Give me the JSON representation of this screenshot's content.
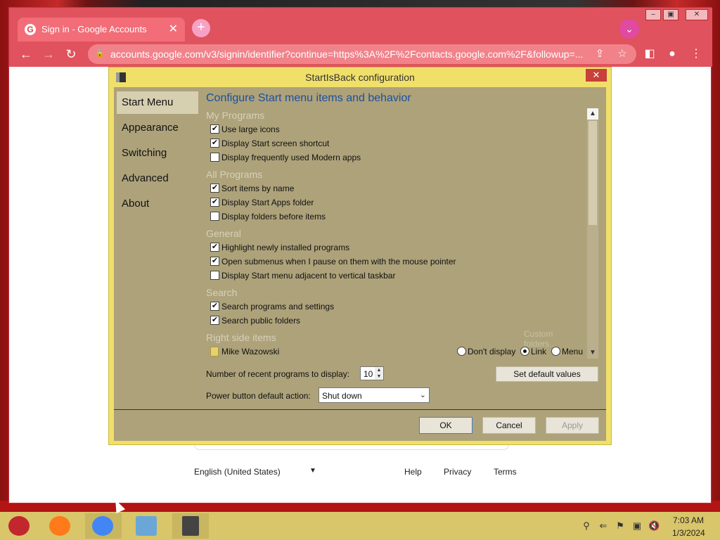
{
  "browser": {
    "tab_title": "Sign in - Google Accounts",
    "url": "accounts.google.com/v3/signin/identifier?continue=https%3A%2F%2Fcontacts.google.com%2F&followup=...",
    "footer": {
      "language": "English (United States)",
      "help": "Help",
      "privacy": "Privacy",
      "terms": "Terms"
    }
  },
  "dialog": {
    "title": "StartIsBack configuration",
    "nav": [
      "Start Menu",
      "Appearance",
      "Switching",
      "Advanced",
      "About"
    ],
    "content_title": "Configure Start menu items and behavior",
    "sections": {
      "my_programs": "My Programs",
      "all_programs": "All Programs",
      "general": "General",
      "search": "Search",
      "right_side": "Right side items"
    },
    "options": [
      {
        "label": "Use large icons",
        "checked": true
      },
      {
        "label": "Display Start screen shortcut",
        "checked": true
      },
      {
        "label": "Display frequently used Modern apps",
        "checked": false
      },
      {
        "label": "Sort items by name",
        "checked": true
      },
      {
        "label": "Display Start Apps folder",
        "checked": true
      },
      {
        "label": "Display folders before items",
        "checked": false
      },
      {
        "label": "Highlight newly installed programs",
        "checked": true
      },
      {
        "label": "Open submenus when I pause on them with the mouse pointer",
        "checked": true
      },
      {
        "label": "Display Start menu adjacent to vertical taskbar",
        "checked": false
      },
      {
        "label": "Search programs and settings",
        "checked": true
      },
      {
        "label": "Search public folders",
        "checked": true
      }
    ],
    "custom_folders": "Custom folders...",
    "user_item": "Mike Wazowski",
    "radio_options": [
      "Don't display",
      "Link",
      "Menu"
    ],
    "radio_selected": "Link",
    "recent_label": "Number of recent programs to display:",
    "recent_value": "10",
    "set_defaults": "Set default values",
    "power_label": "Power button default action:",
    "power_value": "Shut down",
    "buttons": {
      "ok": "OK",
      "cancel": "Cancel",
      "apply": "Apply"
    }
  },
  "taskbar": {
    "time": "7:03 AM",
    "date": "1/3/2024"
  },
  "colors": {
    "dialog_frame": "#f0e06a",
    "dialog_body": "#ada27a",
    "browser_chrome": "#e0525d",
    "link_blue": "#1d4fa0"
  }
}
